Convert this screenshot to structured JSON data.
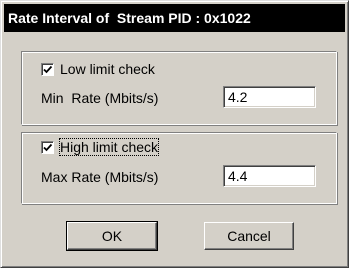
{
  "window": {
    "title": "Rate Interval of  Stream PID : 0x1022"
  },
  "low_limit": {
    "checkbox_label": "Low limit check",
    "checked": true,
    "rate_label": "Min  Rate (Mbits/s)",
    "rate_value": "4.2"
  },
  "high_limit": {
    "checkbox_label": "High limit check",
    "checked": true,
    "rate_label": "Max Rate (Mbits/s)",
    "rate_value": "4.4"
  },
  "buttons": {
    "ok_label": "OK",
    "cancel_label": "Cancel"
  },
  "icons": {
    "checkmark": "checkmark-icon"
  }
}
